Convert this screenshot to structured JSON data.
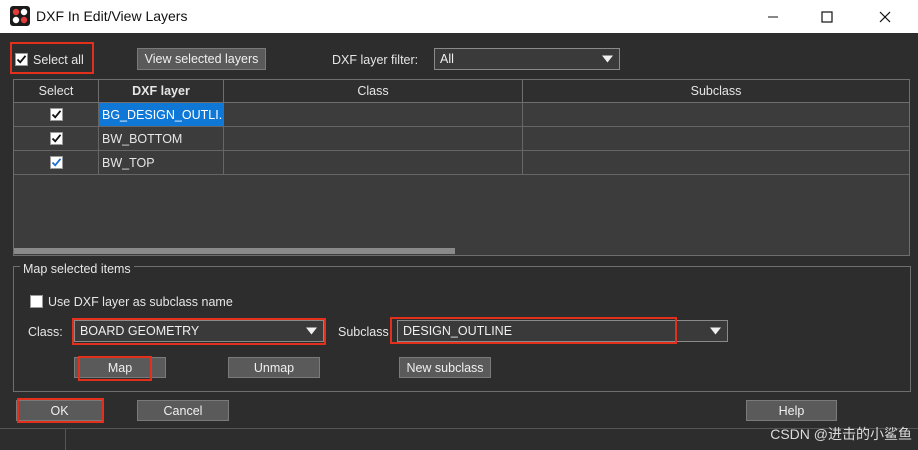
{
  "window": {
    "title": "DXF In Edit/View Layers",
    "app_icon": "cadence-app-icon",
    "controls": [
      "minimize-icon",
      "maximize-icon",
      "close-icon"
    ]
  },
  "toolbar": {
    "select_all_label": "Select all",
    "select_all_checked": true,
    "view_selected_label": "View selected layers",
    "filter_label": "DXF layer filter:",
    "filter_value": "All"
  },
  "grid": {
    "headers": [
      "Select",
      "DXF layer",
      "Class",
      "Subclass"
    ],
    "rows": [
      {
        "checked": true,
        "layer": "BG_DESIGN_OUTLI...",
        "class": "",
        "subclass": "",
        "selected": true
      },
      {
        "checked": true,
        "layer": "BW_BOTTOM",
        "class": "",
        "subclass": "",
        "selected": false
      },
      {
        "checked": true,
        "layer": "BW_TOP",
        "class": "",
        "subclass": "",
        "selected": false
      }
    ]
  },
  "map_group": {
    "title": "Map selected items",
    "use_layer_label": "Use DXF layer as subclass name",
    "use_layer_checked": false,
    "class_label": "Class:",
    "class_value": "BOARD GEOMETRY",
    "subclass_label": "Subclass",
    "subclass_value": "DESIGN_OUTLINE",
    "map_label": "Map",
    "unmap_label": "Unmap",
    "new_subclass_label": "New subclass"
  },
  "footer": {
    "ok_label": "OK",
    "cancel_label": "Cancel",
    "help_label": "Help"
  },
  "watermark": "CSDN @进击的小鲨鱼",
  "colors": {
    "highlight_border": "#e3301d",
    "selection": "#0f78d7",
    "background": "#2d2d2d"
  }
}
